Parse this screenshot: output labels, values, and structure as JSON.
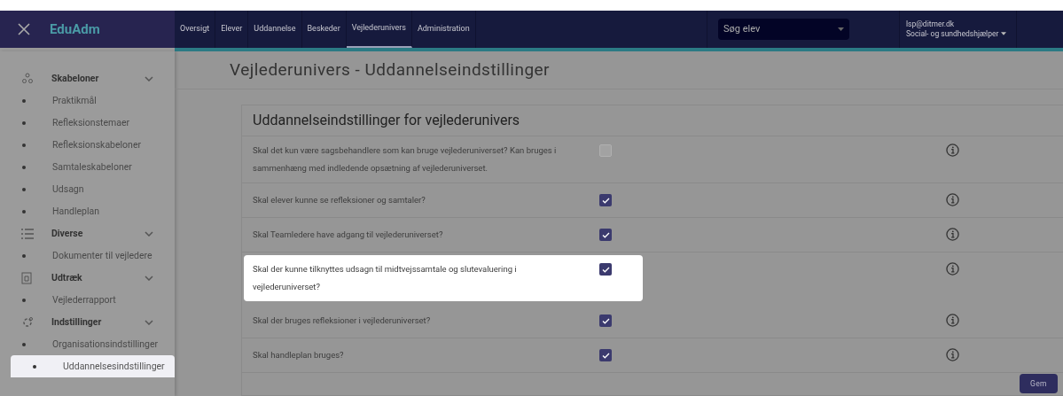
{
  "app": {
    "logo": "EduAdm"
  },
  "nav": [
    {
      "label": "Oversigt",
      "selected": false
    },
    {
      "label": "Elever",
      "selected": false
    },
    {
      "label": "Uddannelse",
      "selected": false
    },
    {
      "label": "Beskeder",
      "selected": false
    },
    {
      "label": "Vejlederunivers",
      "selected": true
    },
    {
      "label": "Administration",
      "selected": false
    }
  ],
  "search": {
    "placeholder": "Søg elev"
  },
  "user": {
    "email": "lsp@ditmer.dk",
    "role": "Social- og sundhedshjælper"
  },
  "sidebar": [
    {
      "kind": "group",
      "label": "Skabeloner",
      "expanded": true,
      "children": [
        {
          "label": "Praktikmål",
          "selected": false
        },
        {
          "label": "Refleksionstemaer",
          "selected": false
        },
        {
          "label": "Refleksionskabeloner",
          "selected": false
        },
        {
          "label": "Samtaleskabeloner",
          "selected": false
        },
        {
          "label": "Udsagn",
          "selected": false
        },
        {
          "label": "Handleplan",
          "selected": false
        }
      ]
    },
    {
      "kind": "group",
      "label": "Diverse",
      "expanded": true,
      "children": [
        {
          "label": "Dokumenter til vejledere",
          "selected": false
        }
      ]
    },
    {
      "kind": "group",
      "label": "Udtræk",
      "expanded": true,
      "children": [
        {
          "label": "Vejlederrapport",
          "selected": false
        }
      ]
    },
    {
      "kind": "group",
      "label": "Indstillinger",
      "expanded": true,
      "children": [
        {
          "label": "Organisationsindstillinger",
          "selected": false
        },
        {
          "label": "Uddannelsesindstillinger",
          "selected": true
        }
      ]
    }
  ],
  "page": {
    "title": "Vejlederunivers - Uddannelseindstillinger"
  },
  "card": {
    "title": "Uddannelseindstillinger for vejlederunivers",
    "settings": [
      {
        "question": "Skal det kun være sagsbehandlere som kan bruge vejlederuniverset? Kan bruges i sammenhæng med indledende opsætning af vejlederuniverset.",
        "checked": false,
        "highlighted": false
      },
      {
        "question": "Skal elever kunne se refleksioner og samtaler?",
        "checked": true,
        "highlighted": false
      },
      {
        "question": "Skal Teamledere have adgang til vejlederuniverset?",
        "checked": true,
        "highlighted": false
      },
      {
        "question": "Skal der kunne tilknyttes udsagn til midtvejssamtale og slutevaluering i vejlederuniverset?",
        "checked": true,
        "highlighted": true
      },
      {
        "question": "Skal der bruges refleksioner i vejlederuniverset?",
        "checked": true,
        "highlighted": false
      },
      {
        "question": "Skal handleplan bruges?",
        "checked": true,
        "highlighted": false
      }
    ],
    "save": "Gem"
  }
}
